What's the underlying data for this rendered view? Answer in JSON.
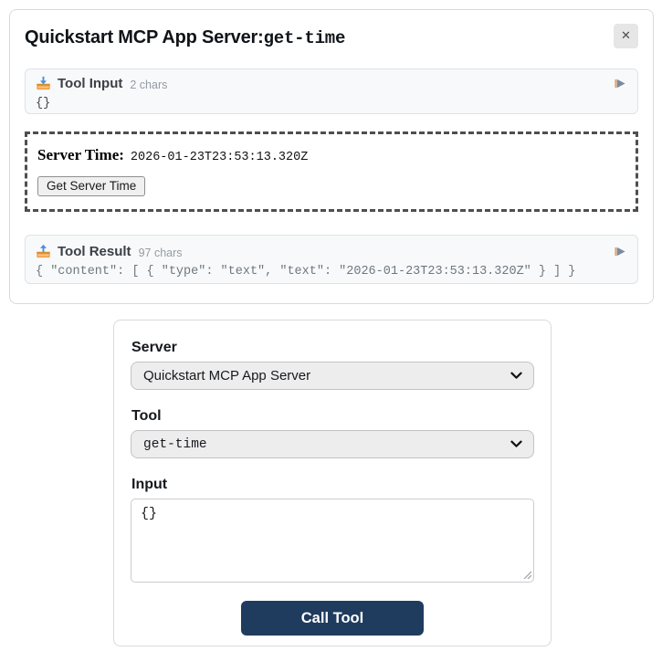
{
  "modal": {
    "title_server": "Quickstart MCP App Server:",
    "title_tool": "get-time",
    "close_icon": "✕",
    "tool_input": {
      "label": "Tool Input",
      "size": "2 chars",
      "content": "{}"
    },
    "embedded_app": {
      "server_time_label": "Server Time:",
      "server_time_value": "2026-01-23T23:53:13.320Z",
      "button_label": "Get Server Time"
    },
    "tool_result": {
      "label": "Tool Result",
      "size": "97 chars",
      "content": "{ \"content\": [ { \"type\": \"text\", \"text\": \"2026-01-23T23:53:13.320Z\" } ] }"
    }
  },
  "form": {
    "server_label": "Server",
    "server_value": "Quickstart MCP App Server",
    "tool_label": "Tool",
    "tool_value": "get-time",
    "input_label": "Input",
    "input_value": "{}",
    "call_button_label": "Call Tool"
  },
  "colors": {
    "accent_button": "#1f3b5e",
    "panel_bg": "#f8f9fa",
    "panel_border": "#dee2e6",
    "card_border": "#d6dade",
    "dashed_border": "#4f4f4f",
    "muted_text": "#939ca6",
    "result_text": "#6e7781",
    "tray_orange": "#f0a24d",
    "arrow_blue": "#4a90d9"
  }
}
